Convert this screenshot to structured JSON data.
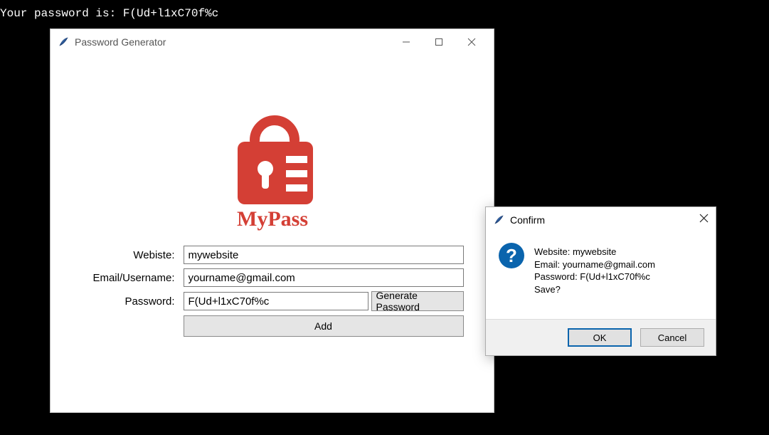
{
  "console": {
    "line": "Your password is: F(Ud+l1xC70f%c"
  },
  "main_window": {
    "title": "Password Generator",
    "logo_text": "MyPass",
    "logo_color": "#d43f35",
    "labels": {
      "website": "Webiste:",
      "email": "Email/Username:",
      "password": "Password:"
    },
    "fields": {
      "website_value": "mywebsite",
      "email_value": "yourname@gmail.com",
      "password_value": "F(Ud+l1xC70f%c"
    },
    "buttons": {
      "generate": "Generate Password",
      "add": "Add"
    },
    "window_controls": {
      "minimize": "minimize",
      "maximize": "maximize",
      "close": "close"
    }
  },
  "dialog": {
    "title": "Confirm",
    "message": {
      "line1": "Website: mywebsite",
      "line2": "Email: yourname@gmail.com",
      "line3": "Password: F(Ud+l1xC70f%c",
      "line4": "Save?"
    },
    "buttons": {
      "ok": "OK",
      "cancel": "Cancel"
    }
  }
}
